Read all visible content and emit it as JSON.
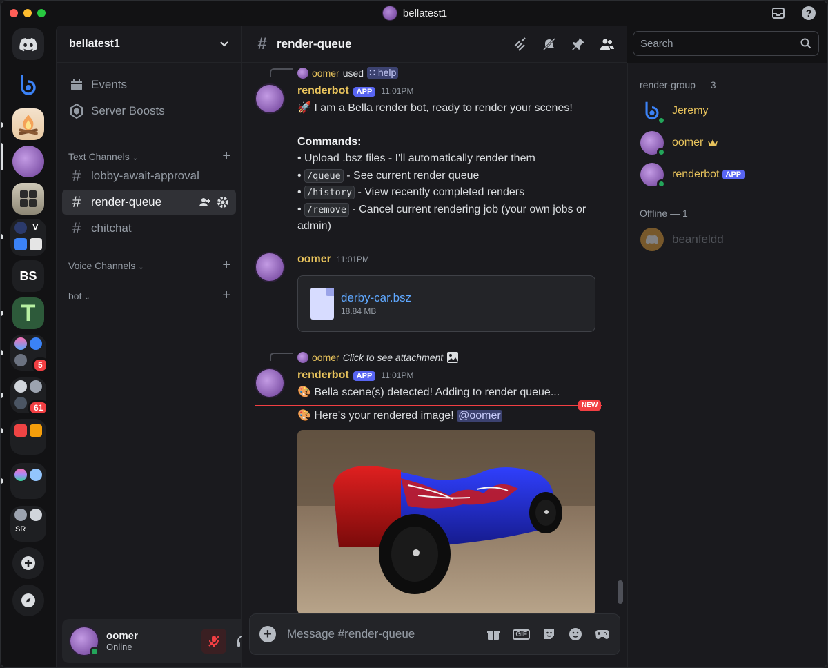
{
  "window": {
    "title": "bellatest1"
  },
  "rail": {
    "servers": [
      {
        "name": "discord-home"
      },
      {
        "name": "bella-logo"
      },
      {
        "name": "campfire-server"
      },
      {
        "name": "levelset-server"
      },
      {
        "name": "calculator-server"
      },
      {
        "name": "v-folder",
        "label": "V"
      },
      {
        "name": "bs-server",
        "label": "BS"
      },
      {
        "name": "t-server",
        "label": "T"
      },
      {
        "name": "folder-1",
        "badge": "5"
      },
      {
        "name": "folder-2",
        "badge": "61"
      },
      {
        "name": "folder-3"
      },
      {
        "name": "folder-4"
      },
      {
        "name": "sr-folder",
        "label": "SR"
      }
    ]
  },
  "sidebar": {
    "guild_name": "bellatest1",
    "events": "Events",
    "boosts": "Server Boosts",
    "text_section": "Text Channels",
    "channels": [
      "lobby-await-approval",
      "render-queue",
      "chitchat"
    ],
    "voice_section": "Voice Channels",
    "bot_section": "bot"
  },
  "user_panel": {
    "name": "oomer",
    "status": "Online"
  },
  "header": {
    "channel": "render-queue",
    "search_placeholder": "Search"
  },
  "messages": {
    "m1": {
      "reply_user": "oomer",
      "reply_used": "used",
      "reply_command": "help",
      "author": "renderbot",
      "tag": "APP",
      "time": "11:01PM",
      "line1": "I am a Bella render bot, ready to render your scenes!",
      "commands_title": "Commands:",
      "bullet1": "• Upload .bsz files - I'll automatically render them",
      "bullet2_code": "/queue",
      "bullet2_text": " - See current render queue",
      "bullet3_code": "/history",
      "bullet3_text": " - View recently completed renders",
      "bullet4_code": "/remove",
      "bullet4_text": " - Cancel current rendering job (your own jobs or admin)"
    },
    "m2": {
      "author": "oomer",
      "time": "11:01PM",
      "file_name": "derby-car.bsz",
      "file_size": "18.84 MB"
    },
    "m3": {
      "reply_user": "oomer",
      "reply_text": "Click to see attachment",
      "author": "renderbot",
      "tag": "APP",
      "time": "11:01PM",
      "line1": "Bella scene(s) detected! Adding to render queue...",
      "new_label": "NEW",
      "line2": "Here's your rendered image!",
      "mention": "@oomer"
    }
  },
  "composer": {
    "placeholder": "Message #render-queue"
  },
  "members": {
    "group1": "render-group — 3",
    "online": [
      {
        "name": "Jeremy"
      },
      {
        "name": "oomer"
      },
      {
        "name": "renderbot",
        "tag": "APP"
      }
    ],
    "group2": "Offline — 1",
    "offline": [
      {
        "name": "beanfeldd"
      }
    ]
  },
  "colors": {
    "accent": "#5865f2",
    "username": "#e8c35c",
    "danger": "#f23f43",
    "online": "#23a55a"
  }
}
